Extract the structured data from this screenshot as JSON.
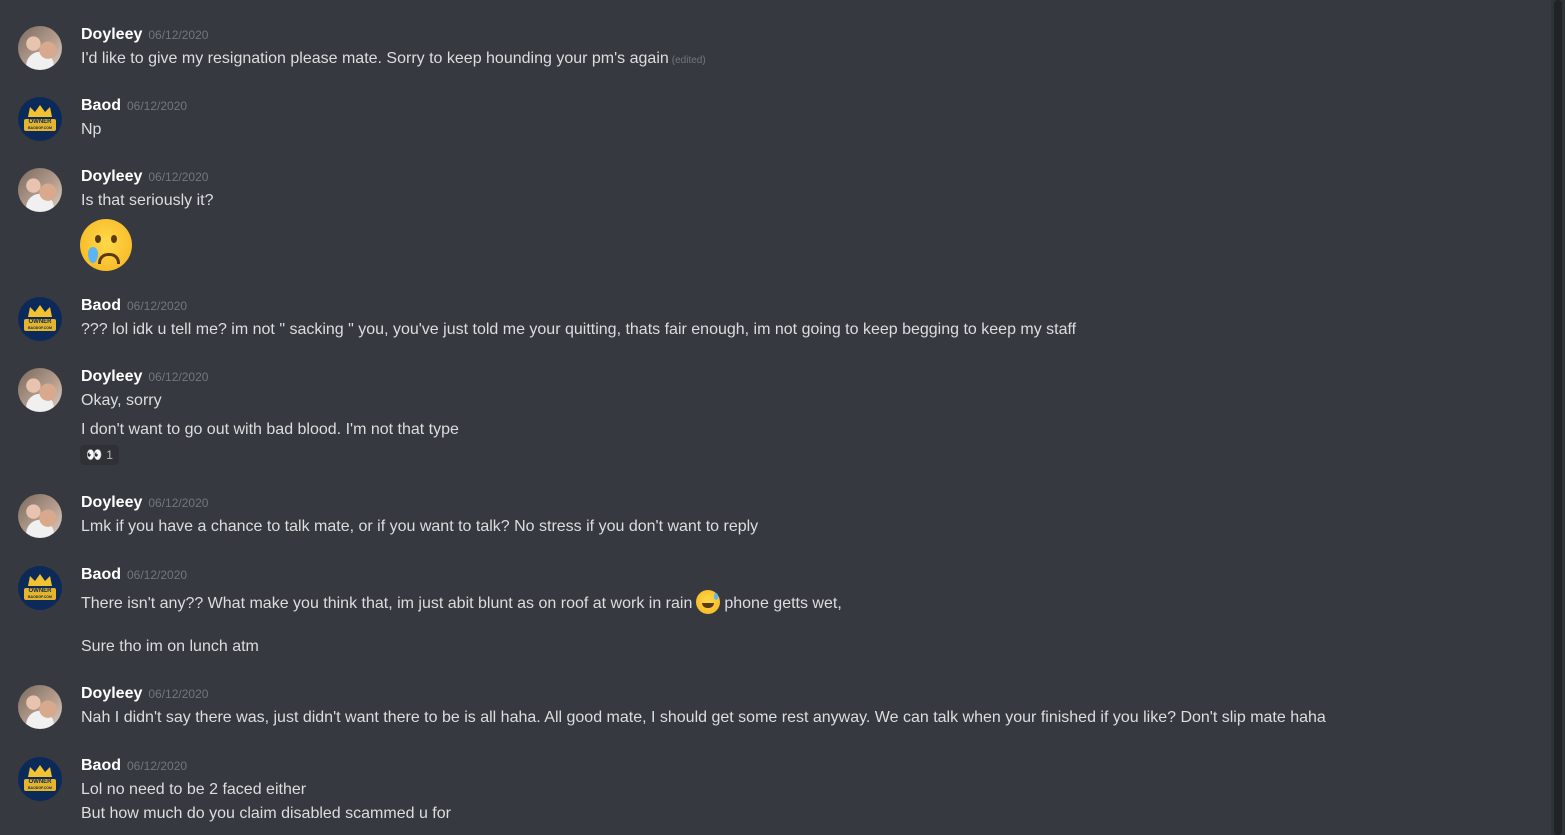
{
  "messages": [
    {
      "author": "Doyleey",
      "timestamp": "06/12/2020",
      "lines": [
        "I'd like to give my resignation please mate. Sorry to keep hounding your pm's again"
      ],
      "edited": "(edited)"
    },
    {
      "author": "Baod",
      "timestamp": "06/12/2020",
      "lines": [
        "Np"
      ]
    },
    {
      "author": "Doyleey",
      "timestamp": "06/12/2020",
      "lines": [
        "Is that seriously it?"
      ],
      "emoji": "cry-emoji"
    },
    {
      "author": "Baod",
      "timestamp": "06/12/2020",
      "lines": [
        "??? lol idk u tell me? im not \" sacking \" you, you've just told me your quitting, thats fair enough, im not going to keep begging to keep my staff"
      ]
    },
    {
      "author": "Doyleey",
      "timestamp": "06/12/2020",
      "lines": [
        "Okay, sorry",
        "I don't want to go out with bad blood. I'm not that type"
      ],
      "reaction": {
        "emoji": "👀",
        "count": "1"
      }
    },
    {
      "author": "Doyleey",
      "timestamp": "06/12/2020",
      "lines": [
        "Lmk if you have a chance to talk mate, or if you want to talk? No stress if you don't want to reply"
      ]
    },
    {
      "author": "Baod",
      "timestamp": "06/12/2020",
      "lines": [
        "There isn't any?? What make you think that, im just abit blunt as on roof at work in rain",
        "phone getts wet,",
        "Sure tho im on lunch atm"
      ]
    },
    {
      "author": "Doyleey",
      "timestamp": "06/12/2020",
      "lines": [
        "Nah I didn't say there was, just didn't want there to be is all haha. All good mate, I should get some rest anyway. We can talk when your finished if you like? Don't slip mate haha"
      ]
    },
    {
      "author": "Baod",
      "timestamp": "06/12/2020",
      "lines": [
        "Lol no need to be 2 faced either",
        "But how much do you claim disabled scammed u for"
      ]
    }
  ],
  "baod_avatar_text": {
    "owner": "OWNER",
    "site": "BAODGF.COM"
  }
}
